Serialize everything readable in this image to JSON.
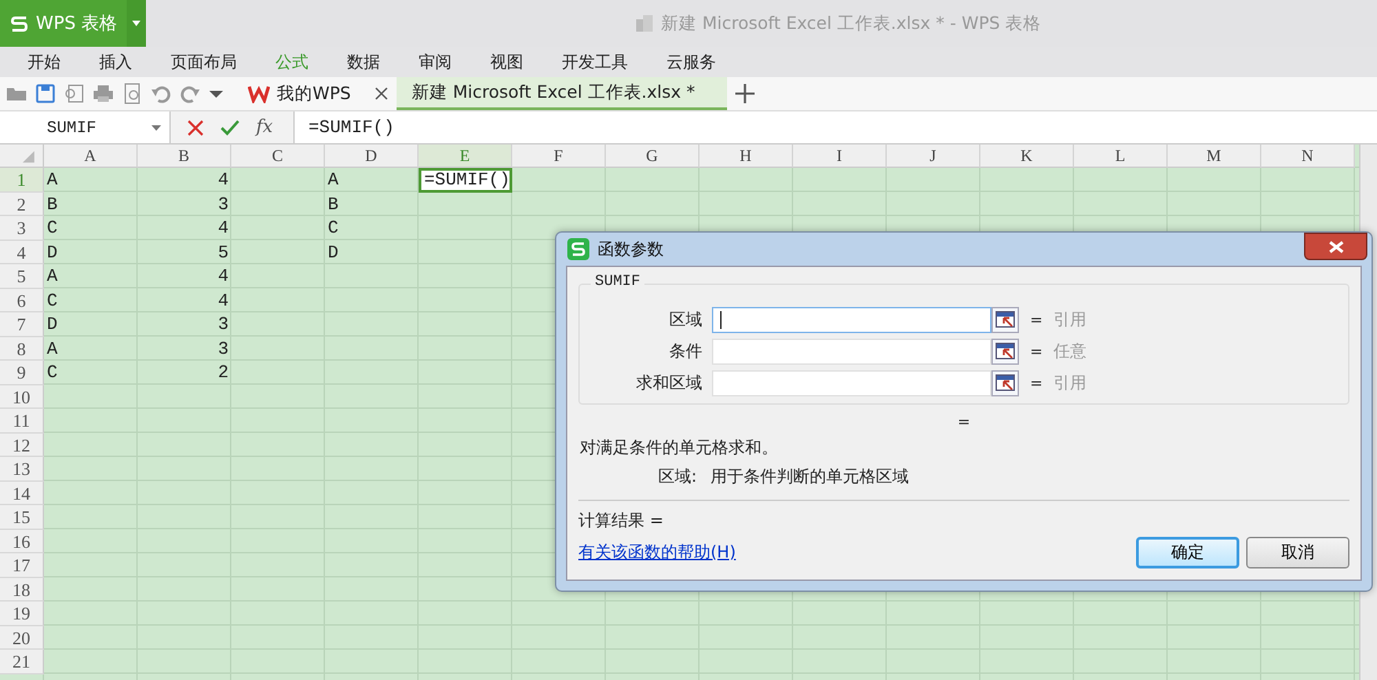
{
  "app": {
    "logo": "WPS 表格",
    "title": "新建 Microsoft Excel 工作表.xlsx * - WPS 表格"
  },
  "menu": [
    {
      "label": "开始",
      "selected": false
    },
    {
      "label": "插入",
      "selected": false
    },
    {
      "label": "页面布局",
      "selected": false
    },
    {
      "label": "公式",
      "selected": true
    },
    {
      "label": "数据",
      "selected": false
    },
    {
      "label": "审阅",
      "selected": false
    },
    {
      "label": "视图",
      "selected": false
    },
    {
      "label": "开发工具",
      "selected": false
    },
    {
      "label": "云服务",
      "selected": false
    }
  ],
  "doc_tabs": [
    {
      "label": "我的WPS",
      "kind": "home",
      "selected": false
    },
    {
      "label": "新建 Microsoft Excel 工作表.xlsx *",
      "kind": "sheet",
      "selected": true
    }
  ],
  "formula_bar": {
    "name_box": "SUMIF",
    "fx": "fx",
    "formula": "=SUMIF()"
  },
  "sheet": {
    "columns": [
      {
        "label": "A",
        "selected": false
      },
      {
        "label": "B",
        "selected": false
      },
      {
        "label": "C",
        "selected": false
      },
      {
        "label": "D",
        "selected": false
      },
      {
        "label": "E",
        "selected": true
      },
      {
        "label": "F",
        "selected": false
      },
      {
        "label": "G",
        "selected": false
      },
      {
        "label": "H",
        "selected": false
      },
      {
        "label": "I",
        "selected": false
      },
      {
        "label": "J",
        "selected": false
      },
      {
        "label": "K",
        "selected": false
      },
      {
        "label": "L",
        "selected": false
      },
      {
        "label": "M",
        "selected": false
      },
      {
        "label": "N",
        "selected": false
      }
    ],
    "rows": [
      {
        "label": "1",
        "selected": true,
        "cells": {
          "A": {
            "text": "A",
            "kind": "text"
          },
          "B": {
            "text": "4",
            "kind": "number"
          },
          "D": {
            "text": "A",
            "kind": "text"
          },
          "E": {
            "text": "=SUMIF()",
            "kind": "text"
          }
        }
      },
      {
        "label": "2",
        "selected": false,
        "cells": {
          "A": {
            "text": "B",
            "kind": "text"
          },
          "B": {
            "text": "3",
            "kind": "number"
          },
          "D": {
            "text": "B",
            "kind": "text"
          }
        }
      },
      {
        "label": "3",
        "selected": false,
        "cells": {
          "A": {
            "text": "C",
            "kind": "text"
          },
          "B": {
            "text": "4",
            "kind": "number"
          },
          "D": {
            "text": "C",
            "kind": "text"
          }
        }
      },
      {
        "label": "4",
        "selected": false,
        "cells": {
          "A": {
            "text": "D",
            "kind": "text"
          },
          "B": {
            "text": "5",
            "kind": "number"
          },
          "D": {
            "text": "D",
            "kind": "text"
          }
        }
      },
      {
        "label": "5",
        "selected": false,
        "cells": {
          "A": {
            "text": "A",
            "kind": "text"
          },
          "B": {
            "text": "4",
            "kind": "number"
          }
        }
      },
      {
        "label": "6",
        "selected": false,
        "cells": {
          "A": {
            "text": "C",
            "kind": "text"
          },
          "B": {
            "text": "4",
            "kind": "number"
          }
        }
      },
      {
        "label": "7",
        "selected": false,
        "cells": {
          "A": {
            "text": "D",
            "kind": "text"
          },
          "B": {
            "text": "3",
            "kind": "number"
          }
        }
      },
      {
        "label": "8",
        "selected": false,
        "cells": {
          "A": {
            "text": "A",
            "kind": "text"
          },
          "B": {
            "text": "3",
            "kind": "number"
          }
        }
      },
      {
        "label": "9",
        "selected": false,
        "cells": {
          "A": {
            "text": "C",
            "kind": "text"
          },
          "B": {
            "text": "2",
            "kind": "number"
          }
        }
      },
      {
        "label": "10",
        "selected": false,
        "cells": {}
      },
      {
        "label": "11",
        "selected": false,
        "cells": {}
      },
      {
        "label": "12",
        "selected": false,
        "cells": {}
      },
      {
        "label": "13",
        "selected": false,
        "cells": {}
      },
      {
        "label": "14",
        "selected": false,
        "cells": {}
      },
      {
        "label": "15",
        "selected": false,
        "cells": {}
      },
      {
        "label": "16",
        "selected": false,
        "cells": {}
      },
      {
        "label": "17",
        "selected": false,
        "cells": {}
      },
      {
        "label": "18",
        "selected": false,
        "cells": {}
      },
      {
        "label": "19",
        "selected": false,
        "cells": {}
      },
      {
        "label": "20",
        "selected": false,
        "cells": {}
      },
      {
        "label": "21",
        "selected": false,
        "cells": {}
      }
    ]
  },
  "dialog": {
    "title": "函数参数",
    "group": "SUMIF",
    "params": [
      {
        "label": "区域",
        "equals": "=",
        "hint": "引用",
        "focused": true
      },
      {
        "label": "条件",
        "equals": "=",
        "hint": "任意",
        "focused": false
      },
      {
        "label": "求和区域",
        "equals": "=",
        "hint": "引用",
        "focused": false
      }
    ],
    "equals": "=",
    "description": "对满足条件的单元格求和。",
    "param_help": {
      "label": "区域:",
      "text": "用于条件判断的单元格区域"
    },
    "result": "计算结果 =",
    "help_link": "有关该函数的帮助(H)",
    "buttons": [
      {
        "label": "确定",
        "default": true
      },
      {
        "label": "取消",
        "default": false
      }
    ]
  }
}
